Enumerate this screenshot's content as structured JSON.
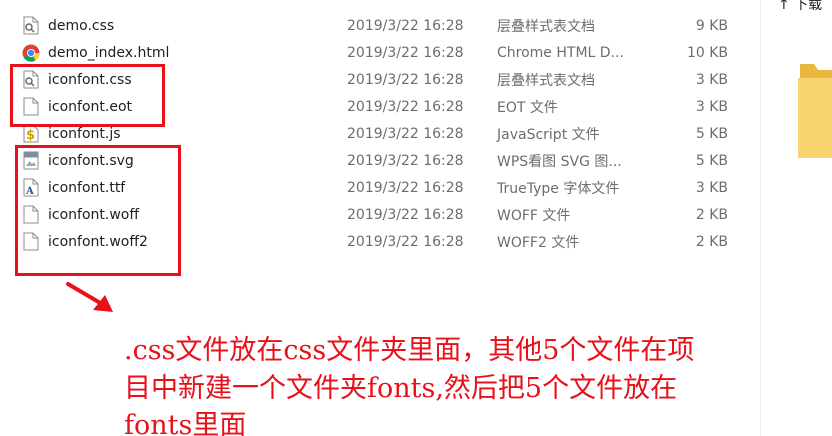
{
  "files": [
    {
      "name": "demo.css",
      "date": "2019/3/22 16:28",
      "type": "层叠样式表文档",
      "size": "9 KB",
      "icon": "css-file-icon"
    },
    {
      "name": "demo_index.html",
      "date": "2019/3/22 16:28",
      "type": "Chrome HTML D...",
      "size": "10 KB",
      "icon": "chrome-icon"
    },
    {
      "name": "iconfont.css",
      "date": "2019/3/22 16:28",
      "type": "层叠样式表文档",
      "size": "3 KB",
      "icon": "css-file-icon"
    },
    {
      "name": "iconfont.eot",
      "date": "2019/3/22 16:28",
      "type": "EOT 文件",
      "size": "3 KB",
      "icon": "blank-file-icon"
    },
    {
      "name": "iconfont.js",
      "date": "2019/3/22 16:28",
      "type": "JavaScript 文件",
      "size": "5 KB",
      "icon": "js-file-icon"
    },
    {
      "name": "iconfont.svg",
      "date": "2019/3/22 16:28",
      "type": "WPS看图 SVG 图...",
      "size": "5 KB",
      "icon": "svg-file-icon"
    },
    {
      "name": "iconfont.ttf",
      "date": "2019/3/22 16:28",
      "type": "TrueType 字体文件",
      "size": "3 KB",
      "icon": "font-file-icon"
    },
    {
      "name": "iconfont.woff",
      "date": "2019/3/22 16:28",
      "type": "WOFF 文件",
      "size": "2 KB",
      "icon": "blank-file-icon"
    },
    {
      "name": "iconfont.woff2",
      "date": "2019/3/22 16:28",
      "type": "WOFF2 文件",
      "size": "2 KB",
      "icon": "blank-file-icon"
    }
  ],
  "right_panel": {
    "partial_text": "↑ 下载",
    "folder_icon": "folder-icon"
  },
  "annotation": {
    "line1": ".css文件放在css文件夹里面，其他5个文件在项",
    "line2": "目中新建一个文件夹fonts,然后把5个文件放在",
    "line3": "fonts里面",
    "color": "#e8101a"
  }
}
